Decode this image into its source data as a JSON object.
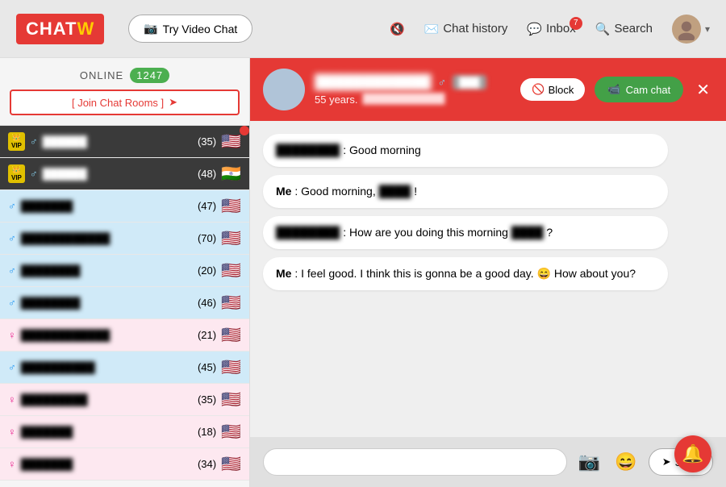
{
  "header": {
    "logo_text": "CHAT",
    "logo_sub": "W",
    "video_btn": "Try Video Chat",
    "chat_history": "Chat history",
    "inbox": "Inbox",
    "inbox_badge": "7",
    "search": "Search"
  },
  "sidebar": {
    "online_label": "ONLINE",
    "online_count": "1247",
    "join_btn": "[ Join Chat Rooms ]",
    "users": [
      {
        "vip": true,
        "gender": "male",
        "age": "35",
        "flag": "🇺🇸",
        "bg": "dark"
      },
      {
        "vip": true,
        "gender": "male",
        "age": "48",
        "flag": "🇮🇳",
        "bg": "dark"
      },
      {
        "vip": false,
        "gender": "male",
        "age": "47",
        "flag": "🇺🇸",
        "bg": "light-blue"
      },
      {
        "vip": false,
        "gender": "male",
        "age": "70",
        "flag": "🇺🇸",
        "bg": "light-blue"
      },
      {
        "vip": false,
        "gender": "male",
        "age": "20",
        "flag": "🇺🇸",
        "bg": "light-blue"
      },
      {
        "vip": false,
        "gender": "male",
        "age": "46",
        "flag": "🇺🇸",
        "bg": "light-blue"
      },
      {
        "vip": false,
        "gender": "female",
        "age": "21",
        "flag": "🇺🇸",
        "bg": "pink"
      },
      {
        "vip": false,
        "gender": "male",
        "age": "45",
        "flag": "🇺🇸",
        "bg": "light-blue"
      },
      {
        "vip": false,
        "gender": "female",
        "age": "35",
        "flag": "🇺🇸",
        "bg": "pink"
      },
      {
        "vip": false,
        "gender": "female",
        "age": "18",
        "flag": "🇺🇸",
        "bg": "pink"
      },
      {
        "vip": false,
        "gender": "female",
        "age": "34",
        "flag": "🇺🇸",
        "bg": "pink"
      }
    ]
  },
  "chat": {
    "user_age": "55 years.",
    "block_btn": "Block",
    "cam_chat_btn": "Cam chat",
    "messages": [
      {
        "sender": "other",
        "text": ": Good morning"
      },
      {
        "sender": "me",
        "me_label": "Me",
        "text": ": Good morning, ",
        "name_part": "blurred",
        "end": "!"
      },
      {
        "sender": "other",
        "text": ": How are you doing this morning "
      },
      {
        "sender": "me",
        "me_label": "Me",
        "text": ": I feel good. I think this is gonna be a good day. 😄 How about you?"
      }
    ],
    "send_btn": "Send",
    "input_placeholder": ""
  }
}
